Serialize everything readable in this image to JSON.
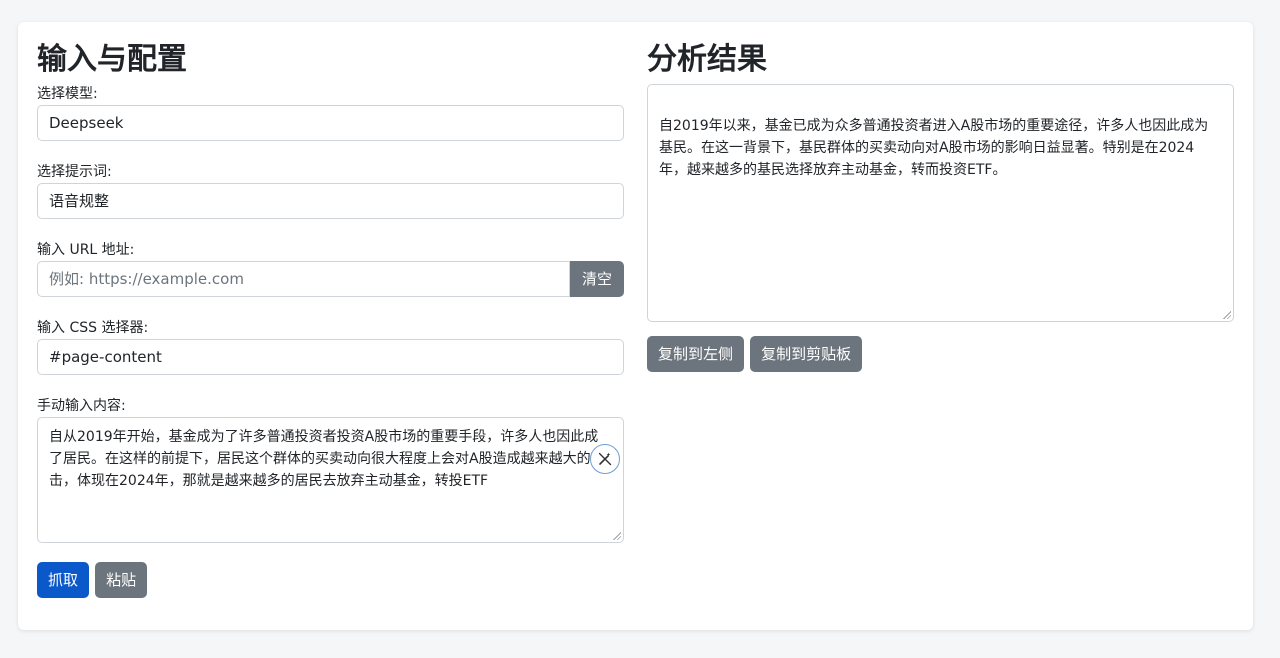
{
  "left": {
    "title": "输入与配置",
    "model": {
      "label": "选择模型:",
      "value": "Deepseek"
    },
    "prompt": {
      "label": "选择提示词:",
      "value": "语音规整"
    },
    "url": {
      "label": "输入 URL 地址:",
      "placeholder": "例如: https://example.com",
      "clear_label": "清空"
    },
    "css": {
      "label": "输入 CSS 选择器:",
      "value": "#page-content"
    },
    "manual": {
      "label": "手动输入内容:",
      "value": "自从2019年开始，基金成为了许多普通投资者投资A股市场的重要手段，许多人也因此成了居民。在这样的前提下，居民这个群体的买卖动向很大程度上会对A股造成越来越大的冲击，体现在2024年，那就是越来越多的居民去放弃主动基金，转投ETF",
      "icon": "magic-wand-icon"
    },
    "buttons": {
      "fetch": "抓取",
      "paste": "粘贴"
    }
  },
  "right": {
    "title": "分析结果",
    "result": "自2019年以来，基金已成为众多普通投资者进入A股市场的重要途径，许多人也因此成为基民。在这一背景下，基民群体的买卖动向对A股市场的影响日益显著。特别是在2024年，越来越多的基民选择放弃主动基金，转而投资ETF。",
    "buttons": {
      "copy_left": "复制到左侧",
      "copy_clipboard": "复制到剪贴板"
    }
  },
  "colors": {
    "primary": "#0a58ca",
    "secondary": "#6c757d",
    "border": "#ced4da",
    "background": "#f5f6f8"
  }
}
